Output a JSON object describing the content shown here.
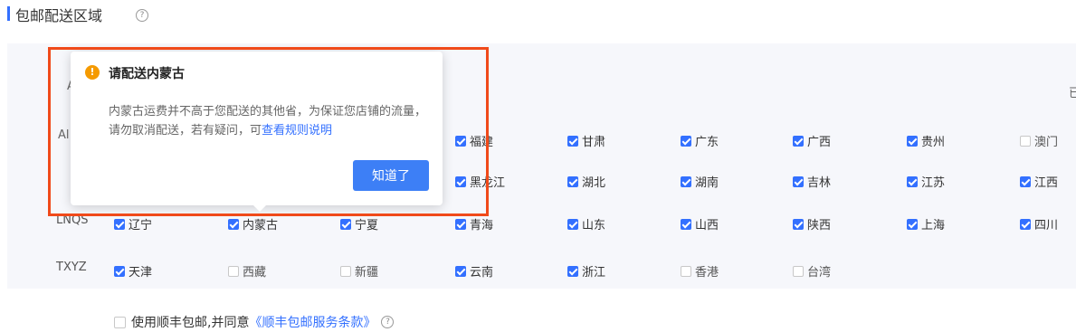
{
  "section": {
    "title": "包邮配送区域",
    "help_glyph": "?"
  },
  "partial_text": {
    "left_fragment": "A",
    "left_fragment_2": "Al",
    "right_fragment": "已"
  },
  "rows": [
    {
      "label": "",
      "provinces": [
        {
          "name": "福建",
          "checked": true
        },
        {
          "name": "甘肃",
          "checked": true
        },
        {
          "name": "广东",
          "checked": true
        },
        {
          "name": "广西",
          "checked": true
        },
        {
          "name": "贵州",
          "checked": true
        },
        {
          "name": "澳门",
          "checked": false
        }
      ]
    },
    {
      "label": "",
      "provinces": [
        {
          "name": "黑龙江",
          "checked": true
        },
        {
          "name": "湖北",
          "checked": true
        },
        {
          "name": "湖南",
          "checked": true
        },
        {
          "name": "吉林",
          "checked": true
        },
        {
          "name": "江苏",
          "checked": true
        },
        {
          "name": "江西",
          "checked": true
        }
      ]
    },
    {
      "label": "LNQS",
      "provinces": [
        {
          "name": "辽宁",
          "checked": true
        },
        {
          "name": "内蒙古",
          "checked": true
        },
        {
          "name": "宁夏",
          "checked": true
        },
        {
          "name": "青海",
          "checked": true
        },
        {
          "name": "山东",
          "checked": true
        },
        {
          "name": "山西",
          "checked": true
        },
        {
          "name": "陕西",
          "checked": true
        },
        {
          "name": "上海",
          "checked": true
        },
        {
          "name": "四川",
          "checked": true
        }
      ]
    },
    {
      "label": "TXYZ",
      "provinces": [
        {
          "name": "天津",
          "checked": true
        },
        {
          "name": "西藏",
          "checked": false
        },
        {
          "name": "新疆",
          "checked": false
        },
        {
          "name": "云南",
          "checked": true
        },
        {
          "name": "浙江",
          "checked": true
        },
        {
          "name": "香港",
          "checked": false
        },
        {
          "name": "台湾",
          "checked": false
        }
      ]
    }
  ],
  "sf_option": {
    "text": "使用顺丰包邮,并同意",
    "link": "《顺丰包邮服务条款》",
    "checked": false
  },
  "popover": {
    "icon_glyph": "!",
    "title": "请配送内蒙古",
    "body": "内蒙古运费并不高于您配送的其他省，为保证您店铺的流量，请勿取消配送，若有疑问，可",
    "link": "查看规则说明",
    "button": "知道了"
  },
  "colors": {
    "accent": "#3370ff",
    "button": "#3d7ff6",
    "warning": "#f59a00",
    "highlight_border": "#f04a1a"
  }
}
